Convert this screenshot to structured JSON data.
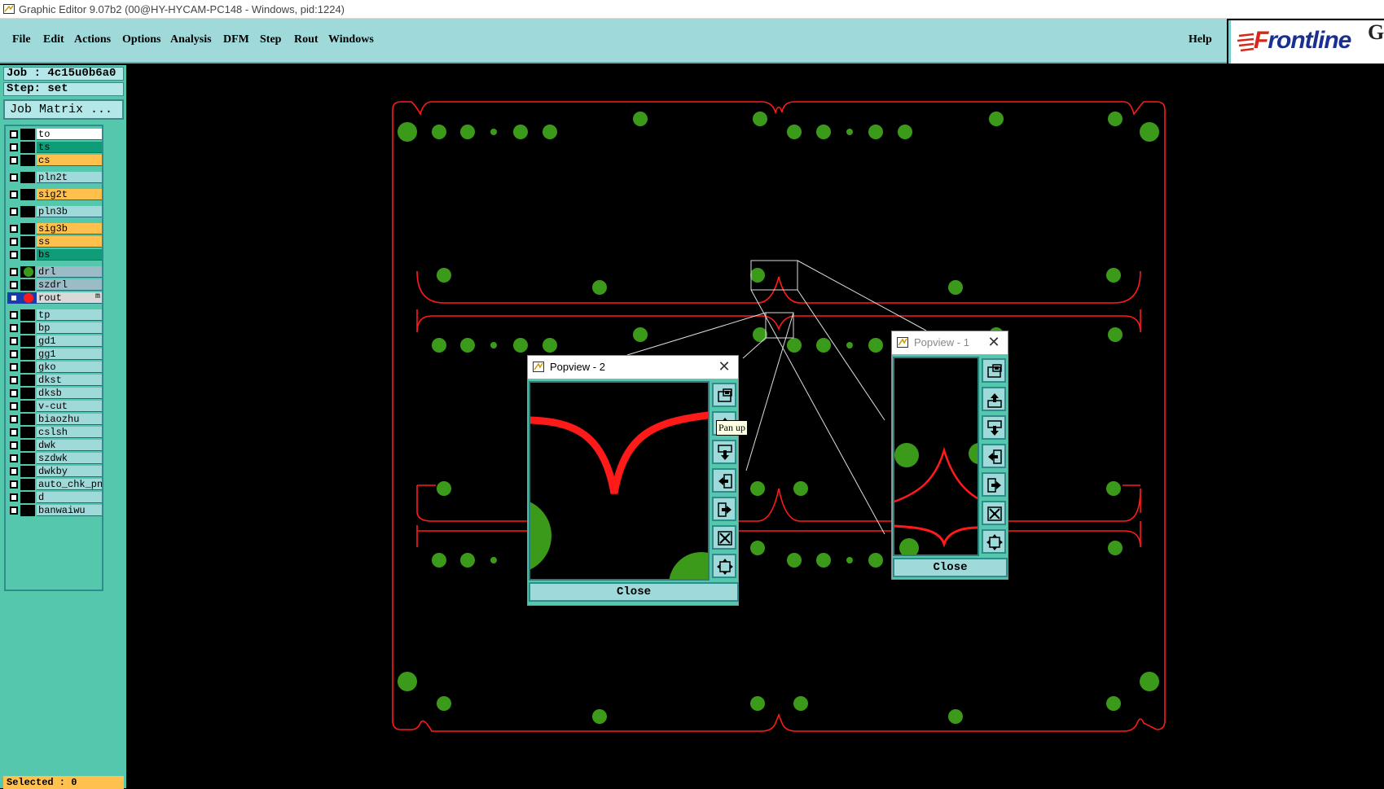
{
  "os_window": {
    "title": "Graphic Editor 9.07b2 (00@HY-HYCAM-PC148 - Windows, pid:1224)"
  },
  "menu": {
    "items": [
      "File",
      "Edit",
      "Actions",
      "Options",
      "Analysis",
      "DFM",
      "Step",
      "Rout",
      "Windows"
    ],
    "help": "Help"
  },
  "logo": {
    "brand_f": "F",
    "brand_rest": "rontline",
    "extra": "Ge"
  },
  "left_panel": {
    "job": "Job : 4c15u0b6a0",
    "step": "Step: set",
    "job_matrix": "Job Matrix ...",
    "layers": [
      {
        "name": "to",
        "bg": "#ffffff",
        "group": 0
      },
      {
        "name": "ts",
        "bg": "#0f9c78",
        "group": 0
      },
      {
        "name": "cs",
        "bg": "#ffc04d",
        "group": 0
      },
      {
        "name": "pln2t",
        "bg": "#9fd9d9",
        "group": 1
      },
      {
        "name": "sig2t",
        "bg": "#ffc04d",
        "group": 2
      },
      {
        "name": "pln3b",
        "bg": "#9fd9d9",
        "group": 3
      },
      {
        "name": "sig3b",
        "bg": "#ffc04d",
        "group": 4
      },
      {
        "name": "ss",
        "bg": "#ffc04d",
        "group": 4
      },
      {
        "name": "bs",
        "bg": "#0f9c78",
        "group": 4
      },
      {
        "name": "drl",
        "bg": "#9bbcc6",
        "group": 5,
        "dot": "#3c9a1a"
      },
      {
        "name": "szdrl",
        "bg": "#9bbcc6",
        "group": 5
      },
      {
        "name": "rout",
        "bg": "#d9d9d9",
        "group": 5,
        "dot": "#ff1a1a",
        "active": true,
        "mark": "m"
      },
      {
        "name": "tp",
        "bg": "#9fd9d9",
        "group": 6
      },
      {
        "name": "bp",
        "bg": "#9fd9d9",
        "group": 6
      },
      {
        "name": "gd1",
        "bg": "#9fd9d9",
        "group": 6
      },
      {
        "name": "gg1",
        "bg": "#9fd9d9",
        "group": 6
      },
      {
        "name": "gko",
        "bg": "#9fd9d9",
        "group": 6
      },
      {
        "name": "dkst",
        "bg": "#9fd9d9",
        "group": 6
      },
      {
        "name": "dksb",
        "bg": "#9fd9d9",
        "group": 6
      },
      {
        "name": "v-cut",
        "bg": "#9fd9d9",
        "group": 6
      },
      {
        "name": "biaozhu",
        "bg": "#9fd9d9",
        "group": 6
      },
      {
        "name": "cslsh",
        "bg": "#9fd9d9",
        "group": 6
      },
      {
        "name": "dwk",
        "bg": "#9fd9d9",
        "group": 6
      },
      {
        "name": "szdwk",
        "bg": "#9fd9d9",
        "group": 6
      },
      {
        "name": "dwkby",
        "bg": "#9fd9d9",
        "group": 6
      },
      {
        "name": "auto_chk_pn.",
        "bg": "#9fd9d9",
        "group": 6
      },
      {
        "name": "d",
        "bg": "#9fd9d9",
        "group": 6
      },
      {
        "name": "banwaiwu",
        "bg": "#9fd9d9",
        "group": 6
      }
    ],
    "selected": "Selected : 0"
  },
  "popview2": {
    "title": "Popview - 2",
    "close_label": "Close",
    "tooltip": "Pan up",
    "buttons": [
      "zoom-window-icon",
      "pan-up-icon",
      "pan-down-icon",
      "pan-left-icon",
      "pan-right-icon",
      "zoom-home-icon",
      "zoom-center-icon"
    ]
  },
  "popview1": {
    "title": "Popview - 1",
    "close_label": "Close",
    "buttons": [
      "zoom-window-icon",
      "pan-up-icon",
      "pan-down-icon",
      "pan-left-icon",
      "pan-right-icon",
      "zoom-home-icon",
      "zoom-center-icon"
    ]
  },
  "colors": {
    "rout": "#ff1a1a",
    "pad": "#3c9a1a",
    "panel": "#55c7ad",
    "menubar": "#9fd9d9"
  }
}
